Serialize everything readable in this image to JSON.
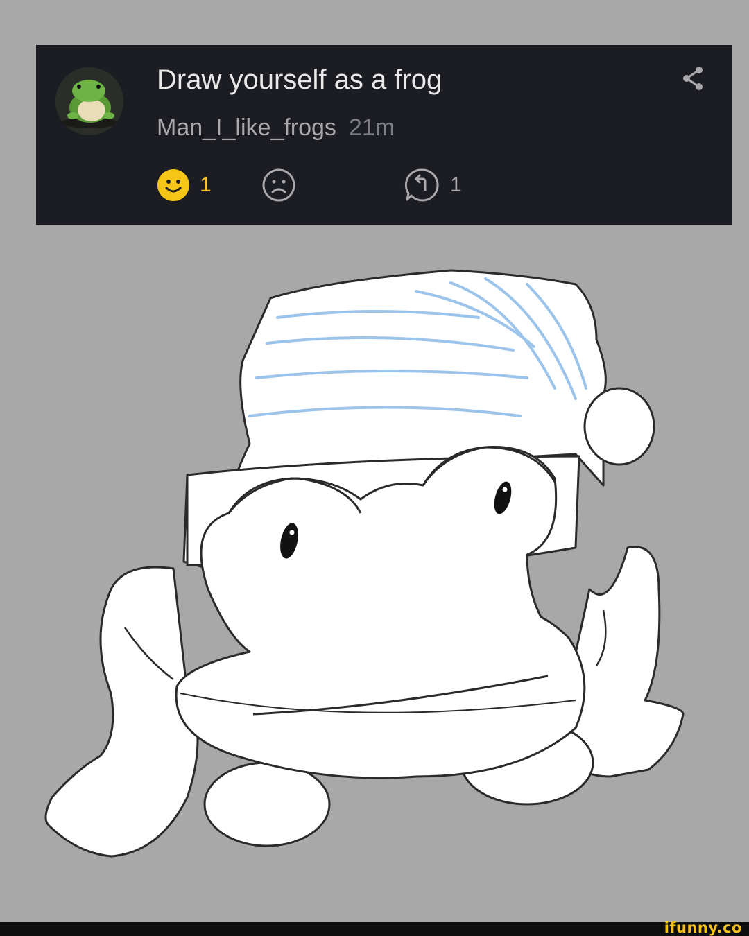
{
  "post": {
    "title": "Draw yourself as a frog",
    "author": "Man_I_like_frogs",
    "time": "21m"
  },
  "actions": {
    "like_count": "1",
    "reply_count": "1"
  },
  "icons": {
    "avatar": "frog-avatar",
    "share": "share-icon",
    "like": "smile-icon",
    "dislike": "frown-icon",
    "reply": "reply-icon"
  },
  "colors": {
    "card_bg": "#1c1d22",
    "page_bg": "#a8a8a8",
    "like_accent": "#f5c518",
    "hat_stripes": "#9cc4ea"
  },
  "watermark": "ifunny.co"
}
